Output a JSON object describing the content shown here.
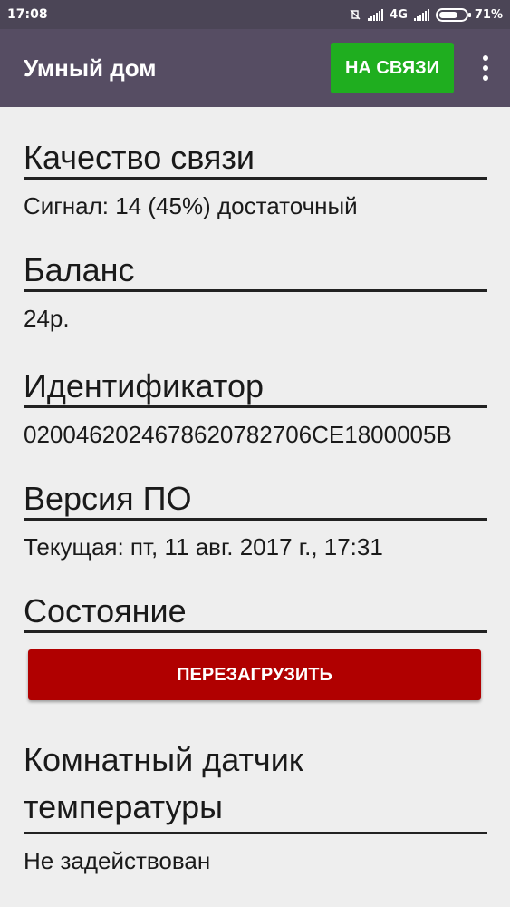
{
  "status_bar": {
    "time": "17:08",
    "network": "4G",
    "battery_percent": "71%",
    "battery_level": 0.71
  },
  "app_bar": {
    "title": "Умный дом",
    "status_button": "НА СВЯЗИ",
    "status_button_color": "#1fae1f",
    "menu_icon": "more-vert-icon"
  },
  "sections": {
    "signal": {
      "title": "Качество связи",
      "value": "Сигнал: 14 (45%) достаточный"
    },
    "balance": {
      "title": "Баланс",
      "value": "24р."
    },
    "identifier": {
      "title": "Идентификатор",
      "value": "0200462024678620782706CE1800005B"
    },
    "firmware": {
      "title": "Версия ПО",
      "value": "Текущая: пт, 11 авг. 2017 г., 17:31"
    },
    "state": {
      "title": "Состояние",
      "reboot_button": "ПЕРЕЗАГРУЗИТЬ",
      "reboot_button_color": "#b00000"
    },
    "temp_sensor": {
      "title": "Комнатный датчик температуры",
      "value": "Не задействован"
    }
  }
}
